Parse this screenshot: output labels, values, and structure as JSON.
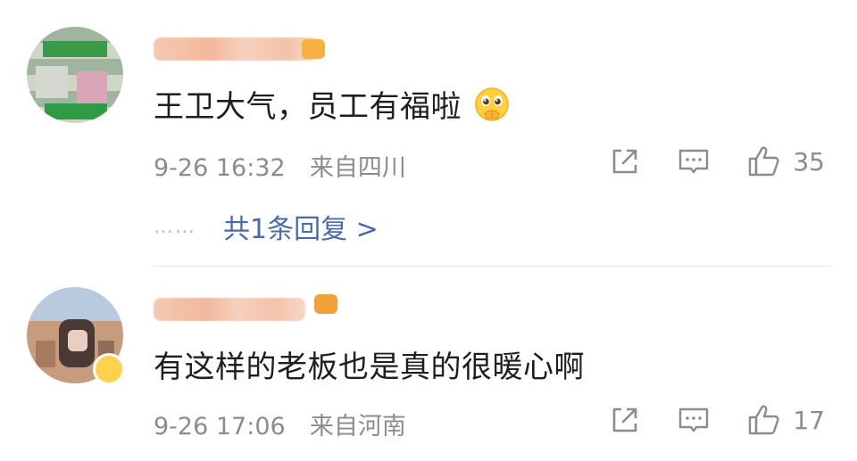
{
  "comments": [
    {
      "text": "王卫大气，员工有福啦",
      "emoji": "pleading-face",
      "time": "9-26 16:32",
      "location": "来自四川",
      "likes": "35",
      "replies_label": "共1条回复 >",
      "dots": "……"
    },
    {
      "text": "有这样的老板也是真的很暖心啊",
      "time": "9-26 17:06",
      "location": "来自河南",
      "likes": "17"
    }
  ],
  "icons": {
    "share": "share-icon",
    "comment": "comment-icon",
    "like": "thumbs-up-icon"
  },
  "colors": {
    "text": "#1f1f1f",
    "meta": "#8c8c8c",
    "link": "#4a6aa8",
    "divider": "#e6e6e6"
  }
}
